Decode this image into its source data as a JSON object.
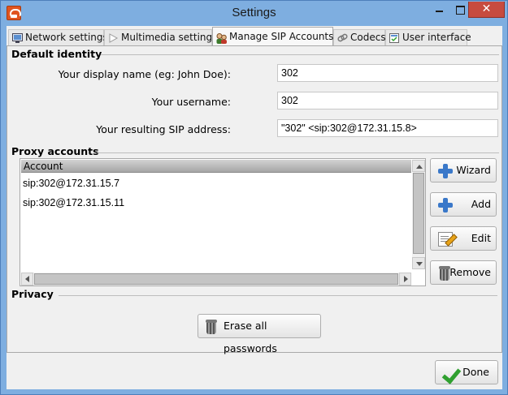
{
  "window": {
    "title": "Settings"
  },
  "tabs": [
    {
      "label": "Network settings",
      "icon": "network-icon"
    },
    {
      "label": "Multimedia settings",
      "icon": "play-icon"
    },
    {
      "label": "Manage SIP Accounts",
      "icon": "accounts-icon",
      "active": true
    },
    {
      "label": "Codecs",
      "icon": "link-icon"
    },
    {
      "label": "User interface",
      "icon": "ui-icon"
    }
  ],
  "identity": {
    "section_title": "Default identity",
    "display_name_label": "Your display name (eg: John Doe):",
    "display_name_value": "302",
    "username_label": "Your username:",
    "username_value": "302",
    "sip_address_label": "Your resulting SIP address:",
    "sip_address_value": "\"302\" <sip:302@172.31.15.8>"
  },
  "proxy": {
    "section_title": "Proxy accounts",
    "column_header": "Account",
    "accounts": [
      "sip:302@172.31.15.7",
      "sip:302@172.31.15.11"
    ],
    "buttons": {
      "wizard": "Wizard",
      "add": "Add",
      "edit": "Edit",
      "remove": "Remove"
    }
  },
  "privacy": {
    "section_title": "Privacy",
    "erase_label": "Erase all passwords"
  },
  "footer": {
    "done_label": "Done"
  },
  "colors": {
    "titlebar": "#7eaee0",
    "close": "#c74b3f",
    "plus": "#3a78c9",
    "check": "#2fa02f"
  }
}
